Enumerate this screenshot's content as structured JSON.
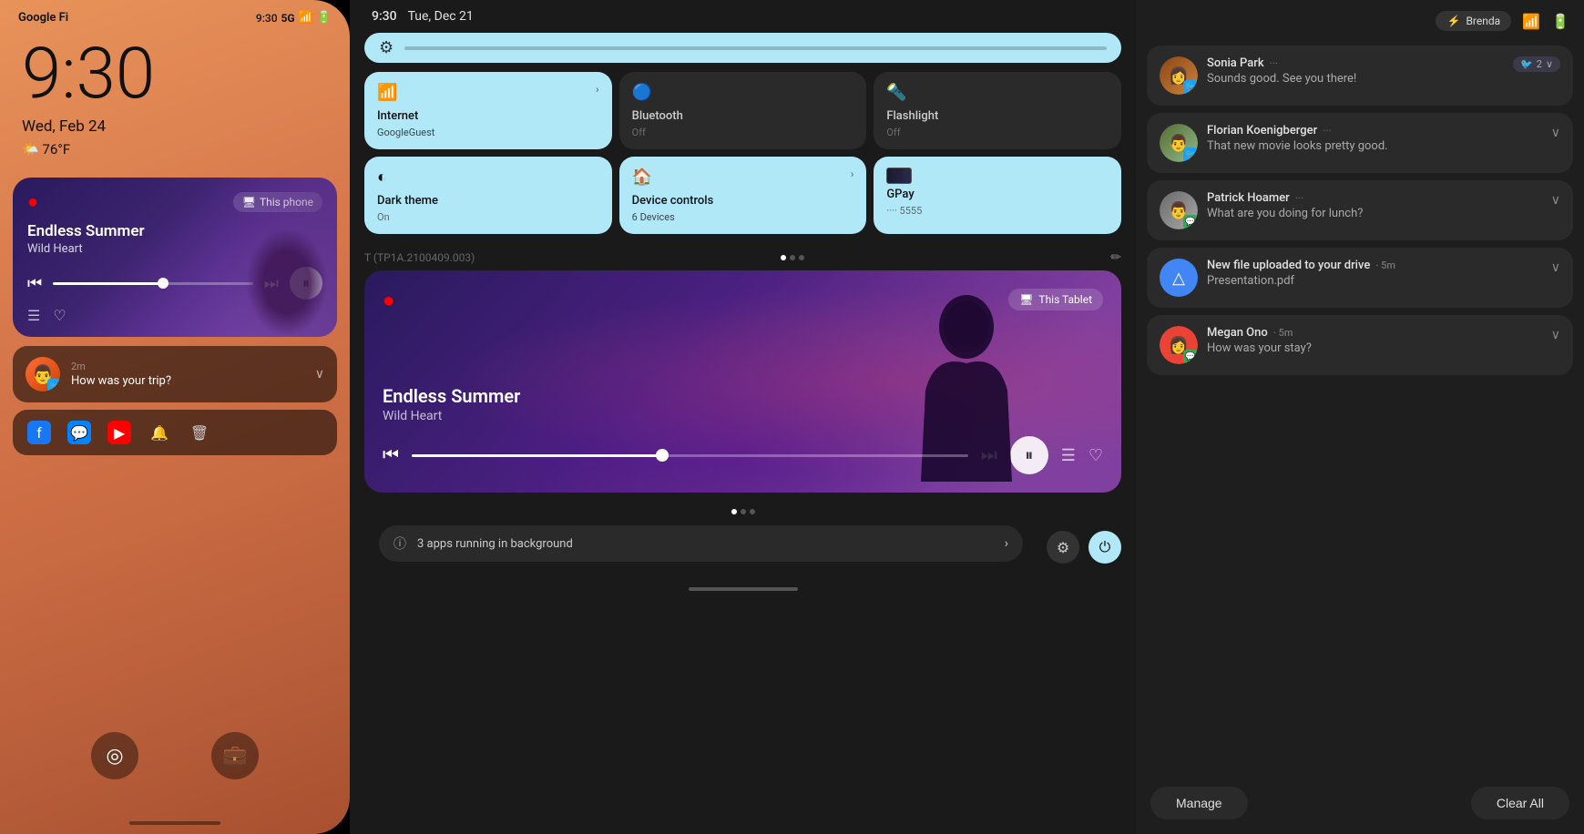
{
  "phone": {
    "carrier": "Google Fi",
    "signal": "5G",
    "time": "9:30",
    "date": "Wed, Feb 24",
    "weather": "🌤️ 76°F",
    "music": {
      "title": "Endless Summer",
      "subtitle": "Wild Heart",
      "device_label": "This phone",
      "device_icon": "🖥"
    },
    "notification": {
      "time": "2m",
      "message": "How was your trip?"
    }
  },
  "tablet": {
    "status_time": "9:30",
    "status_date": "Tue, Dec 21",
    "quick_settings": {
      "brightness_icon": "⚙",
      "tiles": [
        {
          "id": "internet",
          "label": "Internet",
          "sub": "GoogleGuest",
          "icon": "📶",
          "state": "active-arrow",
          "arrow": true
        },
        {
          "id": "bluetooth",
          "label": "Bluetooth",
          "sub": "Off",
          "icon": "🔵",
          "state": "inactive",
          "arrow": false
        },
        {
          "id": "flashlight",
          "label": "Flashlight",
          "sub": "Off",
          "icon": "🔦",
          "state": "inactive",
          "arrow": false
        },
        {
          "id": "dark-theme",
          "label": "Dark theme",
          "sub": "On",
          "icon": "◐",
          "state": "active",
          "arrow": false
        },
        {
          "id": "device-controls",
          "label": "Device controls",
          "sub": "6 Devices",
          "icon": "🏠",
          "state": "active-arrow",
          "arrow": true
        },
        {
          "id": "gpay",
          "label": "GPay",
          "sub": "···· 5555",
          "icon": "💳",
          "state": "active",
          "arrow": false
        }
      ]
    },
    "build": "T (TP1A.2100409.003)",
    "music": {
      "title": "Endless Summer",
      "subtitle": "Wild Heart",
      "device_label": "This Tablet",
      "play_state": "paused"
    },
    "bg_apps": {
      "text": "3 apps running in background",
      "icon": "ℹ"
    }
  },
  "notifications": {
    "panel_user": "Brenda",
    "items": [
      {
        "id": 1,
        "sender": "Sonia Park",
        "message": "Sounds good. See you there!",
        "app_icon": "twitter",
        "avatar_class": "av1",
        "avatar_emoji": "👩",
        "badge_count": "2",
        "expandable": true
      },
      {
        "id": 2,
        "sender": "Florian Koenigberger",
        "message": "That new movie looks pretty good.",
        "app_icon": "twitter",
        "avatar_class": "av2",
        "avatar_emoji": "👨",
        "badge_count": null,
        "expandable": true
      },
      {
        "id": 3,
        "sender": "Patrick Hoamer",
        "message": "What are you doing for lunch?",
        "app_icon": "messages",
        "avatar_class": "av3",
        "avatar_emoji": "👨",
        "badge_count": null,
        "expandable": true
      },
      {
        "id": 4,
        "sender": "New file uploaded to your drive",
        "time": "5m",
        "message": "Presentation.pdf",
        "app_icon": "drive",
        "avatar_class": "av4",
        "is_system": true,
        "expandable": true
      },
      {
        "id": 5,
        "sender": "Megan Ono",
        "time": "5m",
        "message": "How was your stay?",
        "app_icon": "messages",
        "avatar_class": "av5",
        "avatar_emoji": "👩",
        "expandable": true
      }
    ],
    "manage_label": "Manage",
    "clear_all_label": "Clear All"
  },
  "icons": {
    "wifi": "📶",
    "battery": "🔋",
    "fingerprint": "◎",
    "briefcase": "💼",
    "chevron_right": "›",
    "chevron_down": "∨",
    "pause": "⏸",
    "play": "▶",
    "prev": "⏮",
    "next": "⏭",
    "queue": "☰",
    "heart": "♡",
    "settings": "⚙",
    "power": "⏻",
    "info": "ⓘ"
  }
}
